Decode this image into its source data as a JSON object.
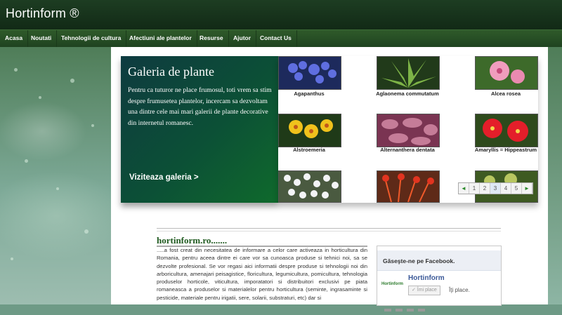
{
  "site": {
    "title": "Hortinform ®"
  },
  "nav": {
    "items": [
      {
        "label": "Acasa"
      },
      {
        "label": "Noutati"
      },
      {
        "label": "Tehnologii de cultura"
      },
      {
        "label": "Afectiuni ale plantelor"
      },
      {
        "label": "Resurse"
      },
      {
        "label": "Ajutor"
      },
      {
        "label": "Contact Us"
      }
    ]
  },
  "gallery": {
    "title": "Galeria de plante",
    "description": "Pentru ca tuturor ne place frumosul, toti vrem sa stim despre frumusetea plantelor, incercam sa dezvoltam una dintre cele mai mari galerii de plante decorative din internetul romanesc.",
    "link_label": "Viziteaza galeria >",
    "plants": [
      {
        "name": "Agapanthus",
        "color": "#4a56b8"
      },
      {
        "name": "Aglaonema commutatum",
        "color": "#5d8a3a"
      },
      {
        "name": "Alcea rosea",
        "color": "#e58bb0"
      },
      {
        "name": "Alstroemeria",
        "color": "#e9b321"
      },
      {
        "name": "Alternanthera dentata",
        "color": "#b45d7a"
      },
      {
        "name": "Amaryllis = Hippeastrum",
        "color": "#d9232c"
      },
      {
        "name": "",
        "color": "#dfe3e8"
      },
      {
        "name": "",
        "color": "#d9582a"
      },
      {
        "name": "",
        "color": "#8aa34a"
      }
    ],
    "pager": {
      "prev": "◄",
      "pages": [
        "1",
        "2",
        "3",
        "4",
        "5"
      ],
      "active_page": 3,
      "next": "►"
    }
  },
  "article": {
    "title": "hortinform.ro.......",
    "text": ".....a fost creat din necesitatea de informare a celor care activeaza in horticultura din Romania, pentru aceea dintre ei care vor sa cunoasca produse si tehnici noi, sa se dezvolte profesional. Se vor regasi aici informatii despre produse si tehnologii noi din arboricultura, amenajari peisagistice, floricultura, legumicultura, pomicultura, tehnologia produselor horticole, viticultura, imporatatori si distribuitori exclusivi pe piata romaneasca a produselor si materialelor pentru horticultura (seminte, ingrasaminte si pesticide, materiale pentru irigatii, sere, solarii, substraturi, etc) dar si"
  },
  "facebook": {
    "title": "Găseşte-ne pe Facebook.",
    "logo_text": "Hortinform",
    "page_name": "Hortinform",
    "like_label": "✓ Îmi place",
    "likes_text": "Îţi place."
  }
}
